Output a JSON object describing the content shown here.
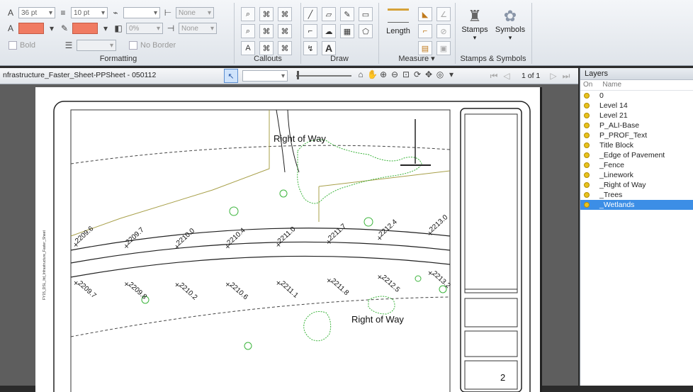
{
  "ribbon": {
    "formatting": {
      "group_label": "Formatting",
      "font_size": "36 pt",
      "line_width": "10 pt",
      "opacity": "0%",
      "start_arrow": "None",
      "end_arrow": "None",
      "bold_label": "Bold",
      "no_border_label": "No Border",
      "colors": {
        "fill": "#f07b62"
      }
    },
    "callouts": {
      "group_label": "Callouts"
    },
    "draw": {
      "group_label": "Draw"
    },
    "measure": {
      "group_label": "Measure",
      "length_label": "Length"
    },
    "stamps": {
      "group_label": "Stamps & Symbols",
      "stamps_label": "Stamps",
      "symbols_label": "Symbols"
    }
  },
  "document": {
    "tab_title": "nfrastructure_Faster_Sheet-PPSheet - 050112",
    "page_of": "1 of 1"
  },
  "drawing": {
    "row_top": "Right of Way",
    "row_bottom": "Right of Way",
    "upper_stations": [
      "2209.6",
      "2209.7",
      "2210.0",
      "2210.4",
      "2211.0",
      "2211.7",
      "2212.4",
      "2213.0"
    ],
    "lower_stations": [
      "2209.7",
      "2209.8",
      "2210.2",
      "2210.6",
      "2211.1",
      "2211.8",
      "2212.5",
      "2213.2"
    ],
    "sheet_number": "2"
  },
  "layers_panel": {
    "title": "Layers",
    "col_on": "On",
    "col_name": "Name",
    "items": [
      "0",
      "Level 14",
      "Level 21",
      "P_ALI-Base",
      "P_PROF_Text",
      "Title Block",
      "_Edge of Pavement",
      "_Fence",
      "_Linework",
      "_Right of Way",
      "_Trees",
      "_Wetlands"
    ],
    "selected_index": 11,
    "colors": {
      "selected": "#3c8ee6",
      "bulb": "#e8c21f"
    }
  }
}
